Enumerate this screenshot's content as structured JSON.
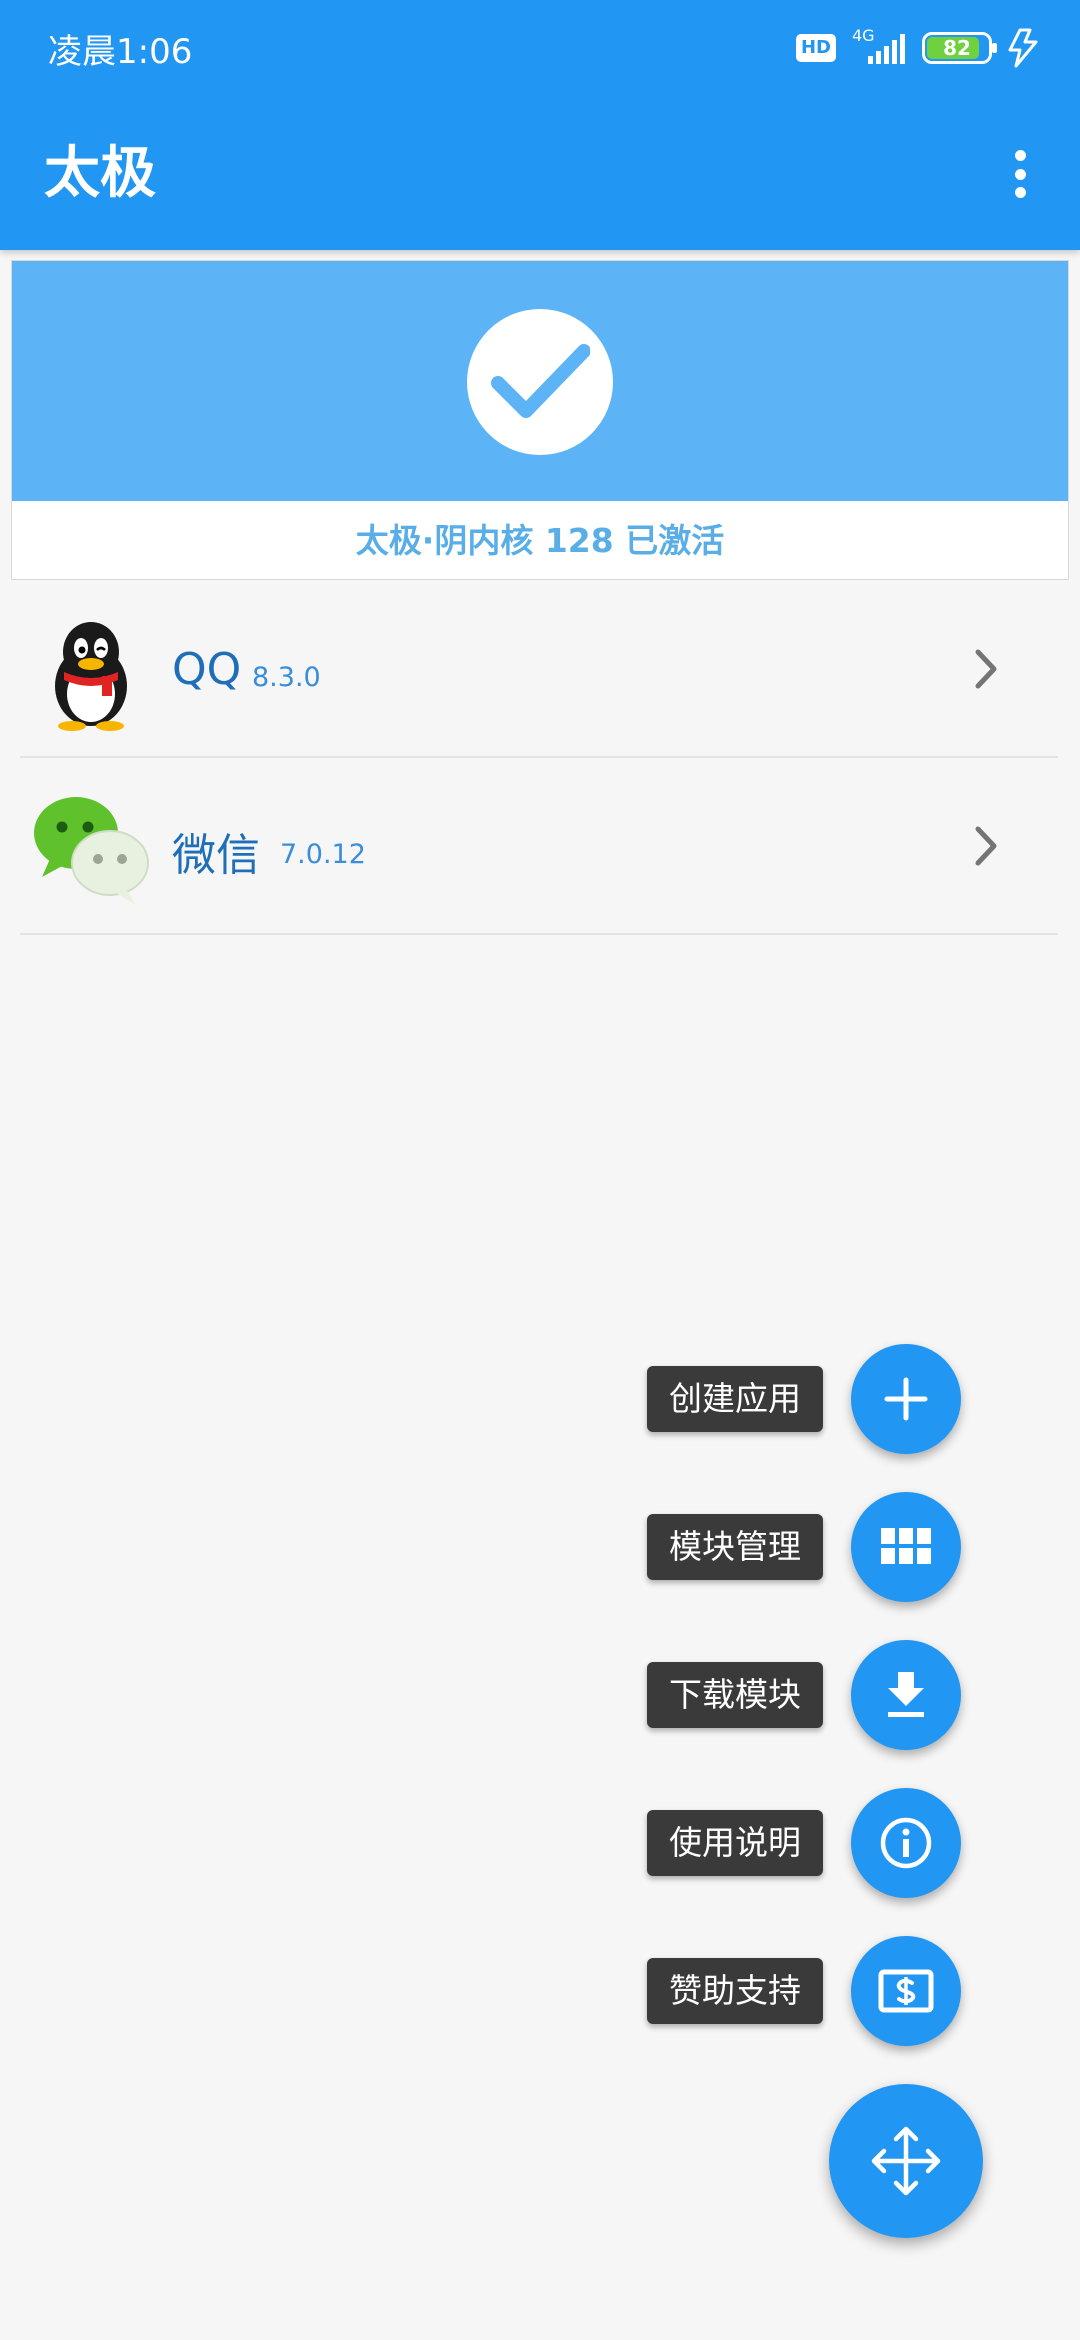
{
  "status_bar": {
    "time": "凌晨1:06",
    "hint": "",
    "hd": "HD",
    "network": "4G",
    "battery": "82"
  },
  "app_bar": {
    "title": "太极"
  },
  "activation": {
    "text": "太极·阴内核 128 已激活"
  },
  "apps": [
    {
      "name": "QQ",
      "version": "8.3.0"
    },
    {
      "name": "微信",
      "version": "7.0.12"
    }
  ],
  "fab_menu": [
    {
      "label": "创建应用",
      "icon": "plus-icon"
    },
    {
      "label": "模块管理",
      "icon": "grid-icon"
    },
    {
      "label": "下载模块",
      "icon": "download-icon"
    },
    {
      "label": "使用说明",
      "icon": "info-icon"
    },
    {
      "label": "赞助支持",
      "icon": "dollar-icon"
    }
  ],
  "fab_main_icon": "move-arrows-icon",
  "colors": {
    "primary": "#2196f3",
    "banner": "#5cb3f6",
    "accent_text": "#5aaee8"
  }
}
